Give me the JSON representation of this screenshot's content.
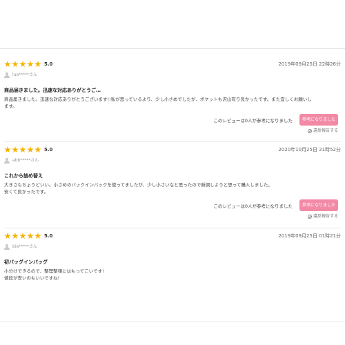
{
  "reviews": [
    {
      "rating": "5.0",
      "stars": 5,
      "date": "2019年09月25日 22時26分",
      "user": "lua*****さん",
      "title": "商品届きました。迅速な対応ありがとうご…",
      "body": "商品届きました。迅速な対応ありがとうございます!!私が思っているより、少し小さめでしたが、ポケットも沢山有り良かったです。また宜しくお願いし\nます。",
      "helpful_text": "このレビューは0人が参考になりました",
      "helpful_button": "参考になりました",
      "report": "違反報告する"
    },
    {
      "rating": "5.0",
      "stars": 5,
      "date": "2020年10月25日 21時52分",
      "user": "abb*****さん",
      "title": "これから詰め替え",
      "body": "大きさもちょうどいい。小さめのバックインバックを使ってましたが、少し小さいなと思ったので新調しようと思って購入しました。\n安くて良かったです。",
      "helpful_text": "このレビューは0人が参考になりました",
      "helpful_button": "参考になりました",
      "report": "違反報告する"
    },
    {
      "rating": "5.0",
      "stars": 5,
      "date": "2019年09月25日 01時21分",
      "user": "bia*****さん",
      "title": "初バッグインバッグ",
      "body": "小分けできるので、整理整頓にはもってこいです!\n値段が安いのもいいですね!"
    }
  ]
}
